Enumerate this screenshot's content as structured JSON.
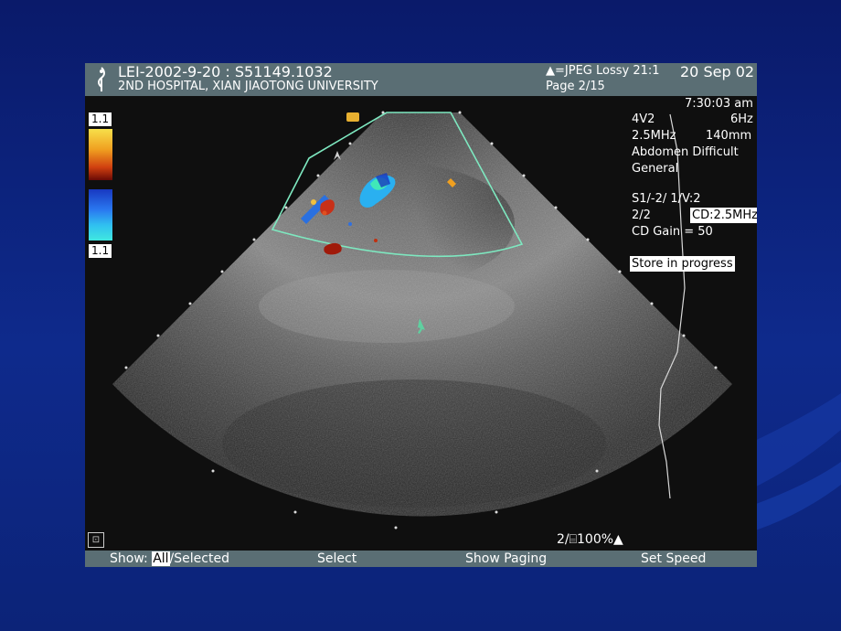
{
  "header": {
    "patient_id": "LEI-2002-9-20 : S51149.1032",
    "institution": "2ND HOSPITAL, XIAN JIAOTONG UNIVERSITY",
    "compression": "▲=JPEG Lossy 21:1",
    "page": "Page 2/15",
    "date": "20 Sep 02"
  },
  "color_scale": {
    "top_label": "1.1",
    "bottom_label": "1.1"
  },
  "params": {
    "time": "7:30:03 am",
    "probe": "4V2",
    "frame_rate": "6Hz",
    "frequency": "2.5MHz",
    "depth": "140mm",
    "preset": "Abdomen Difficult",
    "mode": "General",
    "settings_1": "S1/-2/  1/V:2",
    "settings_2": "2/2",
    "cd_freq": "CD:2.5MHz",
    "cd_gain": "CD Gain =  50",
    "store_status": "Store in progress"
  },
  "status": {
    "zoom": "2/⌸100%▲"
  },
  "footer": {
    "show_prefix": "Show: ",
    "show_all": "All",
    "show_rest": "/Selected",
    "select": "Select",
    "show_paging": "Show Paging",
    "set_speed": "Set Speed"
  },
  "colors": {
    "background": "#0e2a8c",
    "bar": "#5a6e74",
    "roi_outline": "#7ee8c0"
  }
}
